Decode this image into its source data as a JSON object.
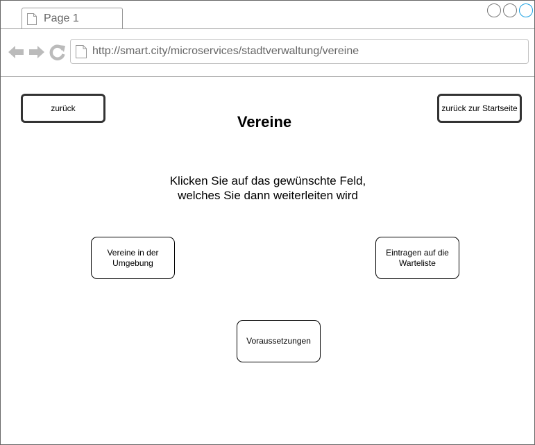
{
  "browser": {
    "tab_label": "Page 1",
    "url": "http://smart.city/microservices/stadtverwaltung/vereine",
    "accent_color": "#1ba1e2"
  },
  "page": {
    "back_button": "zurück",
    "home_button": "zurück zur Startseite",
    "title": "Vereine",
    "instruction_line1": "Klicken Sie auf das gewünschte Feld,",
    "instruction_line2": "welches Sie dann weiterleiten wird",
    "tiles": [
      {
        "label_line1": "Vereine in der",
        "label_line2": "Umgebung"
      },
      {
        "label_line1": "Eintragen auf die",
        "label_line2": "Warteliste"
      },
      {
        "label_line1": "Voraussetzungen"
      }
    ]
  }
}
